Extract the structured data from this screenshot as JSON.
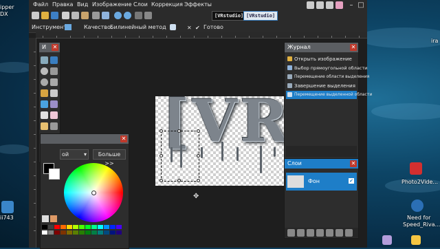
{
  "desktop": {
    "texts": [
      "ipper",
      "DX",
      "ii743",
      "Photo2Vide...",
      "Need for",
      "Speed_Riva...",
      "ira"
    ]
  },
  "menu": [
    "Файл",
    "Правка",
    "Вид",
    "Изображение",
    "Слои",
    "Коррекция",
    "Эффекты"
  ],
  "doc_tabs": [
    "[VRstudio]",
    "[VRstudio]"
  ],
  "optionbar": {
    "tool_label": "Инструмент:",
    "quality_label": "Качество:",
    "quality_value": "Билинейный метод",
    "done_label": "Готово"
  },
  "tools_panel": {
    "title": "И"
  },
  "history": {
    "title": "Журнал",
    "items": [
      {
        "label": "Открыть изображение",
        "icon": "open-image-icon"
      },
      {
        "label": "Выбор прямоугольной области",
        "icon": "rect-select-icon"
      },
      {
        "label": "Перемещение области выделения",
        "icon": "move-selection-icon"
      },
      {
        "label": "Завершение выделения",
        "icon": "finish-selection-icon"
      },
      {
        "label": "Перемещение выделенной области",
        "icon": "move-selected-icon"
      }
    ]
  },
  "layers": {
    "title": "Слои",
    "items": [
      {
        "label": "Фон",
        "checked": true
      }
    ]
  },
  "colors_panel": {
    "dropdown_value": "ой",
    "more_button": "Больше >>"
  },
  "artwork_text": "[VRst",
  "accent": "#1e7ec8"
}
